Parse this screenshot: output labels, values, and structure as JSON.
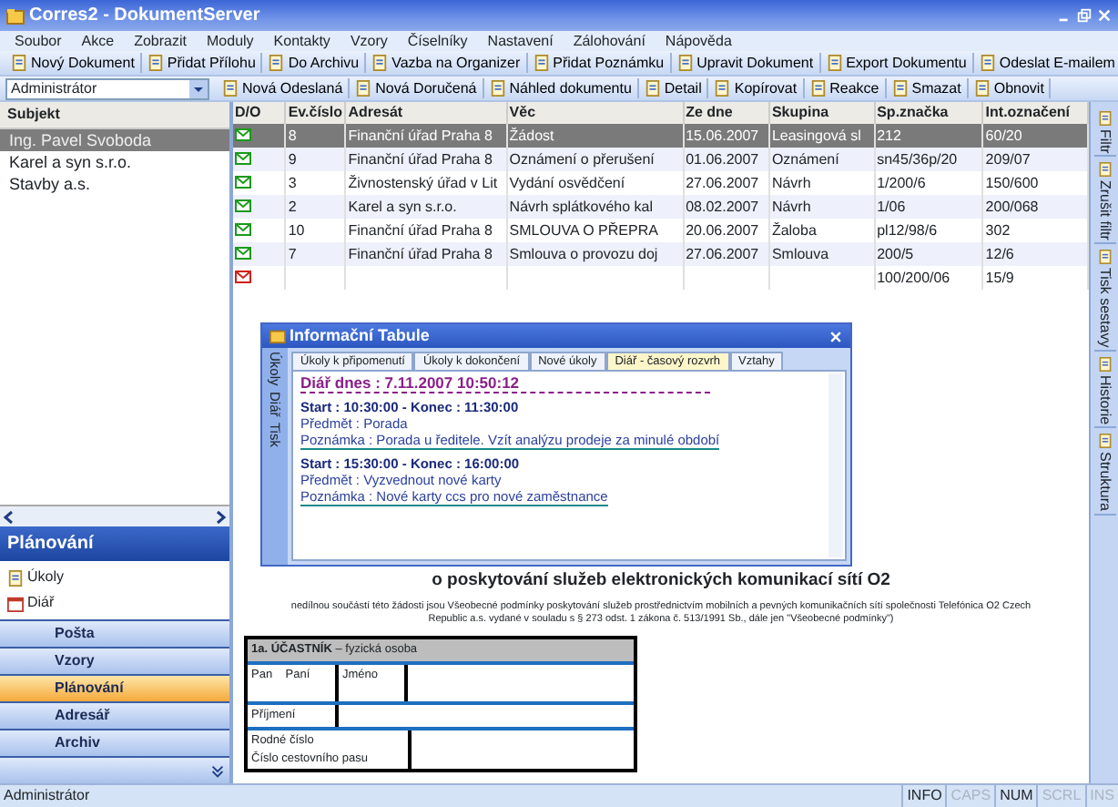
{
  "window": {
    "title": "Corres2 - DokumentServer"
  },
  "menu": [
    "Soubor",
    "Akce",
    "Zobrazit",
    "Moduly",
    "Kontakty",
    "Vzory",
    "Číselníky",
    "Nastavení",
    "Zálohování",
    "Nápověda"
  ],
  "toolbar": [
    "Nový Dokument",
    "Přidat Přílohu",
    "Do Archivu",
    "Vazba na Organizer",
    "Přidat Poznámku",
    "Upravit Dokument",
    "Export Dokumentu",
    "Odeslat E-mailem"
  ],
  "toolbar2": {
    "user_combo": {
      "value": "Administrátor"
    },
    "buttons": [
      "Nová Odeslaná",
      "Nová Doručená",
      "Náhled dokumentu",
      "Detail",
      "Kopírovat",
      "Reakce",
      "Smazat",
      "Obnovit"
    ]
  },
  "subjects": {
    "header": "Subjekt",
    "items": [
      {
        "label": "Ing. Pavel Svoboda",
        "selected": true
      },
      {
        "label": "Karel a syn s.r.o.",
        "selected": false
      },
      {
        "label": "Stavby a.s.",
        "selected": false
      }
    ]
  },
  "planning": {
    "title": "Plánování",
    "items": [
      "Úkoly",
      "Diář"
    ]
  },
  "nav": [
    {
      "label": "Pošta",
      "selected": false
    },
    {
      "label": "Vzory",
      "selected": false
    },
    {
      "label": "Plánování",
      "selected": true
    },
    {
      "label": "Adresář",
      "selected": false
    },
    {
      "label": "Archiv",
      "selected": false
    }
  ],
  "table": {
    "columns": [
      "D/O",
      "Ev.číslo",
      "Adresát",
      "Věc",
      "Ze dne",
      "Skupina",
      "Sp.značka",
      "Int.označení"
    ],
    "rows": [
      {
        "kind": "green",
        "selected": true,
        "cells": [
          null,
          "8",
          "Finanční úřad Praha 8",
          "Žádost",
          "15.06.2007",
          "Leasingová sl",
          "212",
          "60/20"
        ]
      },
      {
        "kind": "green",
        "selected": false,
        "cells": [
          null,
          "9",
          "Finanční úřad Praha 8",
          "Oznámení o přerušení",
          "01.06.2007",
          "Oznámení",
          "sn45/36p/20",
          "209/07"
        ]
      },
      {
        "kind": "green",
        "selected": false,
        "cells": [
          null,
          "3",
          "Živnostenský úřad v Lit",
          "Vydání osvědčení",
          "27.06.2007",
          "Návrh",
          "1/200/6",
          "150/600"
        ]
      },
      {
        "kind": "green",
        "selected": false,
        "cells": [
          null,
          "2",
          "Karel a syn s.r.o.",
          "Návrh splátkového kal",
          "08.02.2007",
          "Návrh",
          "1/06",
          "200/068"
        ]
      },
      {
        "kind": "green",
        "selected": false,
        "cells": [
          null,
          "10",
          "Finanční úřad Praha 8",
          "SMLOUVA O PŘEPRA",
          "20.06.2007",
          "Žaloba",
          "pl12/98/6",
          "302"
        ]
      },
      {
        "kind": "green",
        "selected": false,
        "cells": [
          null,
          "7",
          "Finanční úřad Praha 8",
          "Smlouva o provozu doj",
          "27.06.2007",
          "Smlouva",
          "200/5",
          "12/6"
        ]
      },
      {
        "kind": "red",
        "selected": false,
        "cells": [
          null,
          null,
          null,
          null,
          null,
          null,
          "100/200/06",
          "15/9"
        ]
      }
    ]
  },
  "dialog": {
    "title": "Informační Tabule",
    "side_tabs": [
      "Úkoly",
      "Diář",
      "Tisk"
    ],
    "tabs": [
      {
        "label": "Úkoly k připomenutí",
        "selected": false
      },
      {
        "label": "Úkoly k dokončení",
        "selected": false
      },
      {
        "label": "Nové úkoly",
        "selected": false
      },
      {
        "label": "Diář - časový rozvrh",
        "selected": true
      },
      {
        "label": "Vztahy",
        "selected": false
      }
    ],
    "heading": "Diář dnes : 7.11.2007 10:50:12",
    "entries": [
      {
        "time": "Start : 10:30:00 - Konec : 11:30:00",
        "subject": "Předmět : Porada",
        "note": "Poznámka : Porada u ředitele. Vzít analýzu prodeje za minulé období"
      },
      {
        "time": "Start : 15:30:00 - Konec : 16:00:00",
        "subject": "Předmět : Vyzvednout nové karty",
        "note": "Poznámka : Nové karty ccs pro nové zaměstnance"
      }
    ]
  },
  "document": {
    "title": "o poskytování služeb elektronických komunikací sítí O2",
    "intro": "nedílnou součástí této žádosti jsou Všeobecné podmínky poskytování služeb prostřednictvím mobilních a pevných komunikačních sítí společnosti Telefónica O2 Czech Republic a.s. vydané v souladu s § 273 odst. 1 zákona č. 513/1991 Sb., dále jen \"Všeobecné podmínky\")",
    "section": "**1a. ÚČASTNÍK** – fyzická osoba",
    "salutation": "Pan    Paní",
    "first_name": "Jméno",
    "last_name": "Příjmení",
    "id_lines": [
      "Rodné číslo",
      "Číslo cestovního pasu"
    ]
  },
  "right_tabs": [
    "Filtr",
    "Zrušit filtr",
    "Tisk sestavy",
    "Historie",
    "Struktura"
  ],
  "status_bar": {
    "user": "Administrátor",
    "indicators": [
      {
        "label": "INFO",
        "on": true
      },
      {
        "label": "CAPS",
        "on": false
      },
      {
        "label": "NUM",
        "on": true
      },
      {
        "label": "SCRL",
        "on": false
      },
      {
        "label": "INS",
        "on": false
      }
    ]
  }
}
